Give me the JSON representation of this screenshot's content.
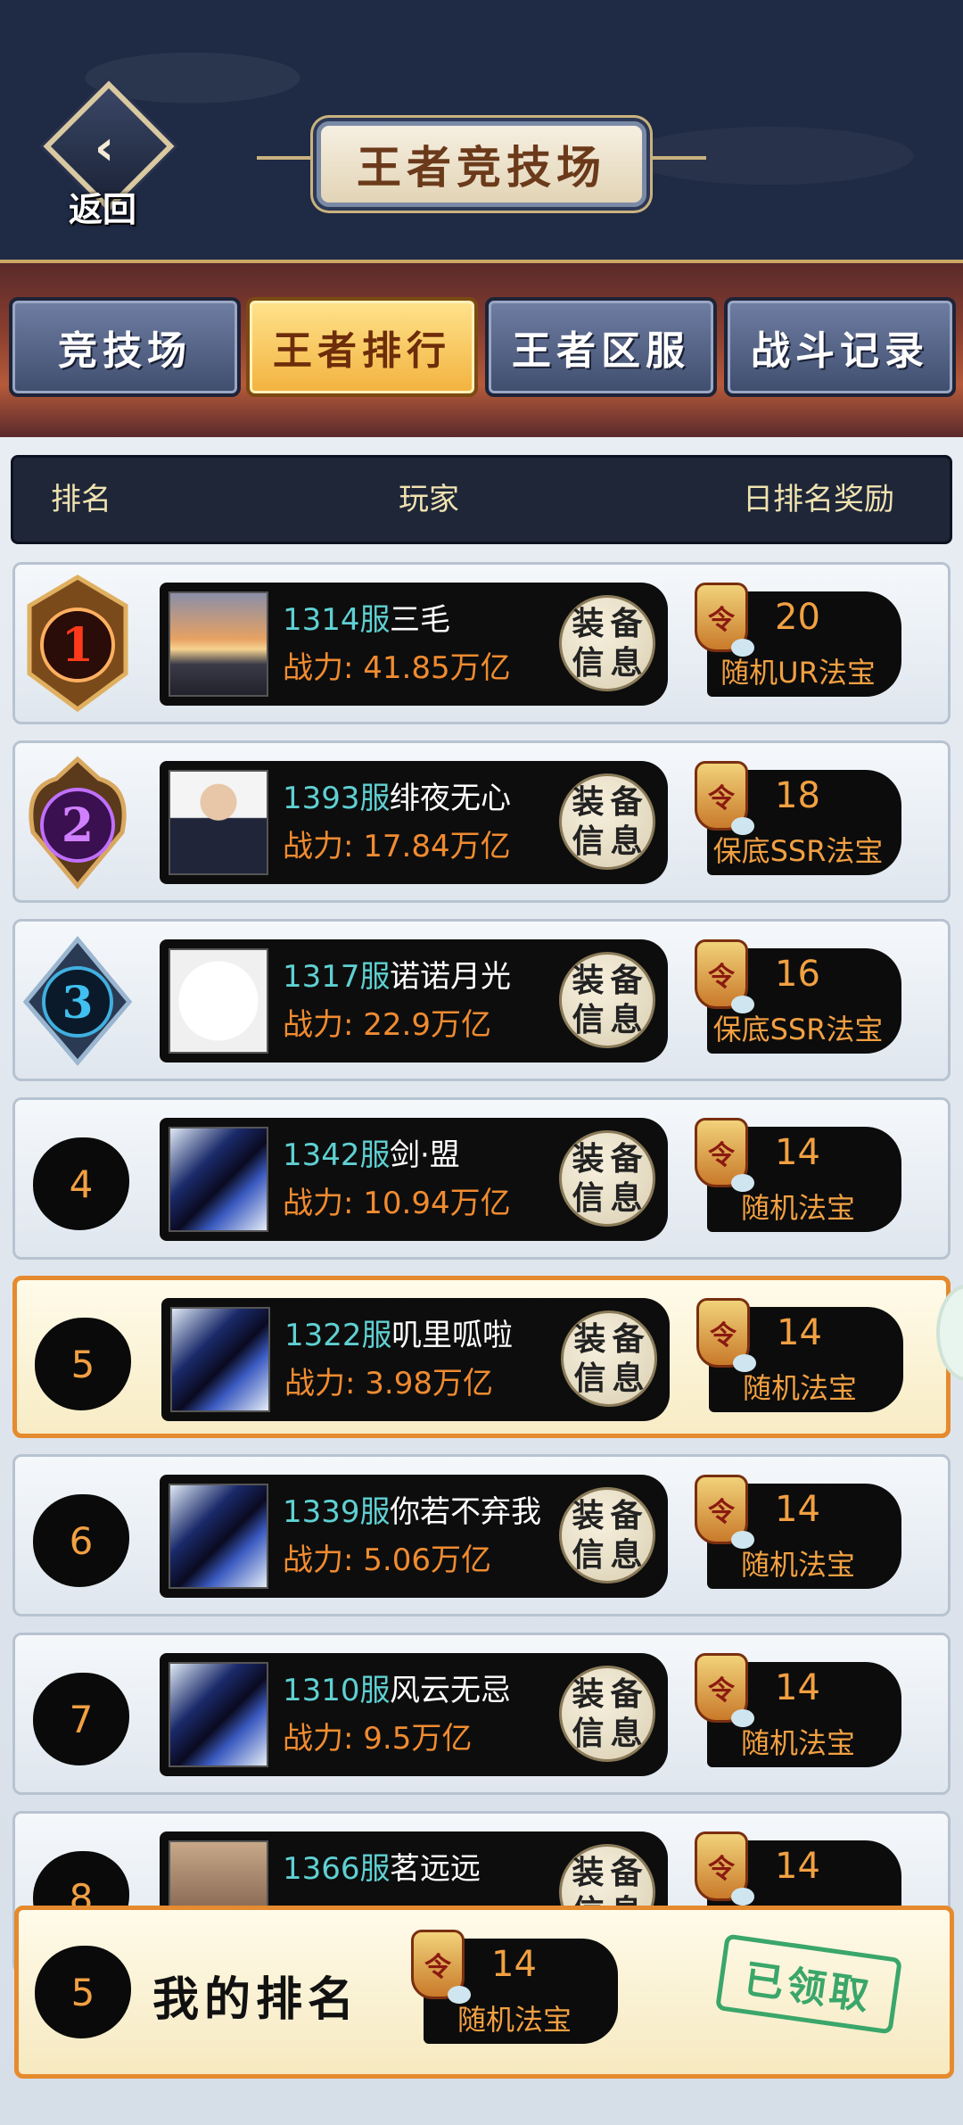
{
  "header": {
    "back_label": "返回",
    "title": "王者竞技场"
  },
  "tabs": [
    {
      "label": "竞技场",
      "active": false
    },
    {
      "label": "王者排行",
      "active": true
    },
    {
      "label": "王者区服",
      "active": false
    },
    {
      "label": "战斗记录",
      "active": false
    }
  ],
  "columns": {
    "rank": "排名",
    "player": "玩家",
    "reward": "日排名奖励"
  },
  "equip_label": [
    "装",
    "备",
    "信",
    "息"
  ],
  "token_label": "令",
  "rows": [
    {
      "rank": "1",
      "server": "1314服",
      "name": "三毛",
      "power": "战力: 41.85万亿",
      "reward_count": "20",
      "reward_name": "随机UR法宝"
    },
    {
      "rank": "2",
      "server": "1393服",
      "name": "绯夜无心",
      "power": "战力: 17.84万亿",
      "reward_count": "18",
      "reward_name": "保底SSR法宝"
    },
    {
      "rank": "3",
      "server": "1317服",
      "name": "诺诺月光",
      "power": "战力: 22.9万亿",
      "reward_count": "16",
      "reward_name": "保底SSR法宝"
    },
    {
      "rank": "4",
      "server": "1342服",
      "name": "剑·盟",
      "power": "战力: 10.94万亿",
      "reward_count": "14",
      "reward_name": "随机法宝"
    },
    {
      "rank": "5",
      "server": "1322服",
      "name": "叽里呱啦",
      "power": "战力: 3.98万亿",
      "reward_count": "14",
      "reward_name": "随机法宝"
    },
    {
      "rank": "6",
      "server": "1339服",
      "name": "你若不弃我",
      "power": "战力: 5.06万亿",
      "reward_count": "14",
      "reward_name": "随机法宝"
    },
    {
      "rank": "7",
      "server": "1310服",
      "name": "风云无忌",
      "power": "战力: 9.5万亿",
      "reward_count": "14",
      "reward_name": "随机法宝"
    },
    {
      "rank": "8",
      "server": "1366服",
      "name": "茗远远",
      "power": "",
      "reward_count": "14",
      "reward_name": ""
    }
  ],
  "my_rank": {
    "rank": "5",
    "label": "我的排名",
    "reward_count": "14",
    "reward_name": "随机法宝",
    "status": "已领取"
  },
  "colors": {
    "header_bg": "#1f2a44",
    "tab_active": "#f2b23e",
    "server_text": "#5fd0d2",
    "power_text": "#f08b30",
    "highlight_border": "#e58a2e",
    "claimed_green": "#3aa66a"
  }
}
